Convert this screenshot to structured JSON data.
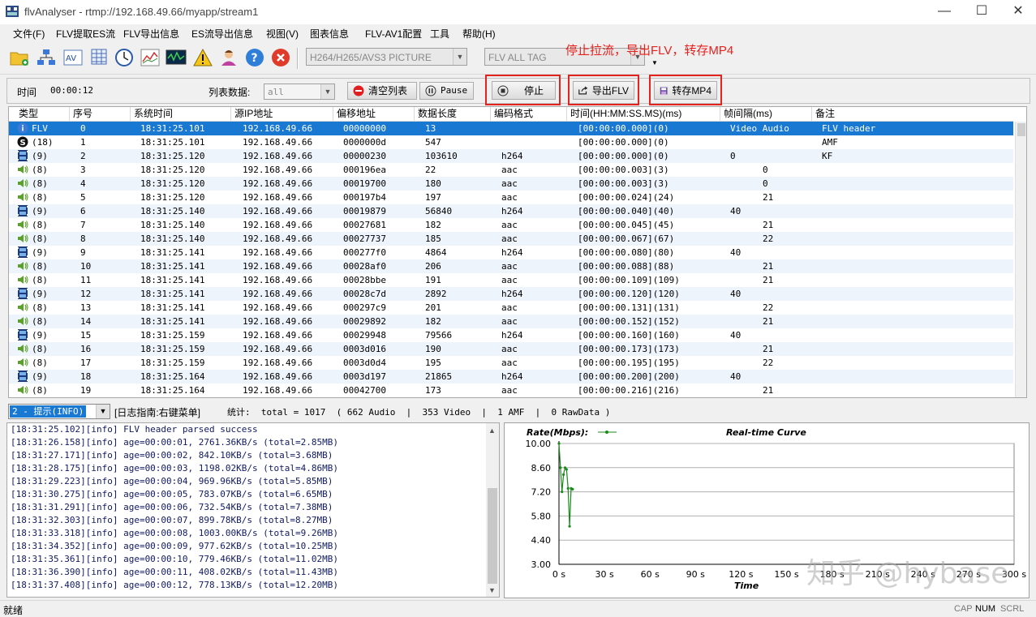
{
  "window": {
    "title": "flvAnalyser - rtmp://192.168.49.66/myapp/stream1",
    "minimize": "—",
    "maximize": "☐",
    "close": "✕"
  },
  "menu": [
    "文件(F)",
    "FLV提取ES流",
    "FLV导出信息",
    "ES流导出信息",
    "视图(V)",
    "图表信息",
    "FLV-AV1配置",
    "工具",
    "帮助(H)"
  ],
  "toolbar": {
    "icons": [
      "open-folder-icon",
      "network-icon",
      "av-icon",
      "grid-icon",
      "clock-icon",
      "chart-icon",
      "monitor-wave-icon",
      "warning-icon",
      "user-icon",
      "help-icon",
      "stop-circle-icon"
    ],
    "picture_combo": "H264/H265/AVS3 PICTURE",
    "tag_combo": "FLV ALL TAG"
  },
  "annotation": "停止拉流，导出FLV，转存MP4",
  "controls": {
    "time_label": "时间",
    "time_value": "00:00:12",
    "list_data_label": "列表数据:",
    "list_data_value": "all",
    "clear_label": "清空列表",
    "pause_label": "Pause",
    "stop_label": "停止",
    "export_flv_label": "导出FLV",
    "to_mp4_label": "转存MP4"
  },
  "table": {
    "columns": [
      "类型",
      "序号",
      "系统时间",
      "源IP地址",
      "偏移地址",
      "数据长度",
      "编码格式",
      "时间(HH:MM:SS.MS)(ms)",
      "帧间隔(ms)",
      "备注"
    ],
    "rows": [
      {
        "icon": "info",
        "type": "FLV",
        "seq": "0",
        "time": "18:31:25.101",
        "ip": "192.168.49.66",
        "offset": "00000000",
        "len": "13",
        "codec": "",
        "ts": "[00:00:00.000](0)",
        "interval": "Video  Audio",
        "note": "FLV header"
      },
      {
        "icon": "script",
        "type": "(18)",
        "seq": "1",
        "time": "18:31:25.101",
        "ip": "192.168.49.66",
        "offset": "0000000d",
        "len": "547",
        "codec": "",
        "ts": "[00:00:00.000](0)",
        "interval": "",
        "note": "AMF"
      },
      {
        "icon": "video",
        "type": "(9)",
        "seq": "2",
        "time": "18:31:25.120",
        "ip": "192.168.49.66",
        "offset": "00000230",
        "len": "103610",
        "codec": "h264",
        "ts": "[00:00:00.000](0)",
        "interval": "0",
        "note": "KF"
      },
      {
        "icon": "audio",
        "type": "(8)",
        "seq": "3",
        "time": "18:31:25.120",
        "ip": "192.168.49.66",
        "offset": "000196ea",
        "len": "22",
        "codec": "aac",
        "ts": "[00:00:00.003](3)",
        "interval": "0",
        "note": ""
      },
      {
        "icon": "audio",
        "type": "(8)",
        "seq": "4",
        "time": "18:31:25.120",
        "ip": "192.168.49.66",
        "offset": "00019700",
        "len": "180",
        "codec": "aac",
        "ts": "[00:00:00.003](3)",
        "interval": "0",
        "note": ""
      },
      {
        "icon": "audio",
        "type": "(8)",
        "seq": "5",
        "time": "18:31:25.120",
        "ip": "192.168.49.66",
        "offset": "000197b4",
        "len": "197",
        "codec": "aac",
        "ts": "[00:00:00.024](24)",
        "interval": "21",
        "note": ""
      },
      {
        "icon": "video",
        "type": "(9)",
        "seq": "6",
        "time": "18:31:25.140",
        "ip": "192.168.49.66",
        "offset": "00019879",
        "len": "56840",
        "codec": "h264",
        "ts": "[00:00:00.040](40)",
        "interval": "40",
        "note": ""
      },
      {
        "icon": "audio",
        "type": "(8)",
        "seq": "7",
        "time": "18:31:25.140",
        "ip": "192.168.49.66",
        "offset": "00027681",
        "len": "182",
        "codec": "aac",
        "ts": "[00:00:00.045](45)",
        "interval": "21",
        "note": ""
      },
      {
        "icon": "audio",
        "type": "(8)",
        "seq": "8",
        "time": "18:31:25.140",
        "ip": "192.168.49.66",
        "offset": "00027737",
        "len": "185",
        "codec": "aac",
        "ts": "[00:00:00.067](67)",
        "interval": "22",
        "note": ""
      },
      {
        "icon": "video",
        "type": "(9)",
        "seq": "9",
        "time": "18:31:25.141",
        "ip": "192.168.49.66",
        "offset": "000277f0",
        "len": "4864",
        "codec": "h264",
        "ts": "[00:00:00.080](80)",
        "interval": "40",
        "note": ""
      },
      {
        "icon": "audio",
        "type": "(8)",
        "seq": "10",
        "time": "18:31:25.141",
        "ip": "192.168.49.66",
        "offset": "00028af0",
        "len": "206",
        "codec": "aac",
        "ts": "[00:00:00.088](88)",
        "interval": "21",
        "note": ""
      },
      {
        "icon": "audio",
        "type": "(8)",
        "seq": "11",
        "time": "18:31:25.141",
        "ip": "192.168.49.66",
        "offset": "00028bbe",
        "len": "191",
        "codec": "aac",
        "ts": "[00:00:00.109](109)",
        "interval": "21",
        "note": ""
      },
      {
        "icon": "video",
        "type": "(9)",
        "seq": "12",
        "time": "18:31:25.141",
        "ip": "192.168.49.66",
        "offset": "00028c7d",
        "len": "2892",
        "codec": "h264",
        "ts": "[00:00:00.120](120)",
        "interval": "40",
        "note": ""
      },
      {
        "icon": "audio",
        "type": "(8)",
        "seq": "13",
        "time": "18:31:25.141",
        "ip": "192.168.49.66",
        "offset": "000297c9",
        "len": "201",
        "codec": "aac",
        "ts": "[00:00:00.131](131)",
        "interval": "22",
        "note": ""
      },
      {
        "icon": "audio",
        "type": "(8)",
        "seq": "14",
        "time": "18:31:25.141",
        "ip": "192.168.49.66",
        "offset": "00029892",
        "len": "182",
        "codec": "aac",
        "ts": "[00:00:00.152](152)",
        "interval": "21",
        "note": ""
      },
      {
        "icon": "video",
        "type": "(9)",
        "seq": "15",
        "time": "18:31:25.159",
        "ip": "192.168.49.66",
        "offset": "00029948",
        "len": "79566",
        "codec": "h264",
        "ts": "[00:00:00.160](160)",
        "interval": "40",
        "note": ""
      },
      {
        "icon": "audio",
        "type": "(8)",
        "seq": "16",
        "time": "18:31:25.159",
        "ip": "192.168.49.66",
        "offset": "0003d016",
        "len": "190",
        "codec": "aac",
        "ts": "[00:00:00.173](173)",
        "interval": "21",
        "note": ""
      },
      {
        "icon": "audio",
        "type": "(8)",
        "seq": "17",
        "time": "18:31:25.159",
        "ip": "192.168.49.66",
        "offset": "0003d0d4",
        "len": "195",
        "codec": "aac",
        "ts": "[00:00:00.195](195)",
        "interval": "22",
        "note": ""
      },
      {
        "icon": "video",
        "type": "(9)",
        "seq": "18",
        "time": "18:31:25.164",
        "ip": "192.168.49.66",
        "offset": "0003d197",
        "len": "21865",
        "codec": "h264",
        "ts": "[00:00:00.200](200)",
        "interval": "40",
        "note": ""
      },
      {
        "icon": "audio",
        "type": "(8)",
        "seq": "19",
        "time": "18:31:25.164",
        "ip": "192.168.49.66",
        "offset": "00042700",
        "len": "173",
        "codec": "aac",
        "ts": "[00:00:00.216](216)",
        "interval": "21",
        "note": ""
      }
    ]
  },
  "stats": {
    "level": "2 - 提示(INFO)",
    "log_hint": "[日志指南:右键菜单]",
    "text": "统计:  total = 1017  ( 662 Audio  |  353 Video  |  1 AMF  |  0 RawData )"
  },
  "log": [
    "[18:31:25.102][info] FLV header parsed success",
    "[18:31:26.158][info] age=00:00:01, 2761.36KB/s (total=2.85MB)",
    "[18:31:27.171][info] age=00:00:02, 842.10KB/s (total=3.68MB)",
    "[18:31:28.175][info] age=00:00:03, 1198.02KB/s (total=4.86MB)",
    "[18:31:29.223][info] age=00:00:04, 969.96KB/s (total=5.85MB)",
    "[18:31:30.275][info] age=00:00:05, 783.07KB/s (total=6.65MB)",
    "[18:31:31.291][info] age=00:00:06, 732.54KB/s (total=7.38MB)",
    "[18:31:32.303][info] age=00:00:07, 899.78KB/s (total=8.27MB)",
    "[18:31:33.318][info] age=00:00:08, 1003.00KB/s (total=9.26MB)",
    "[18:31:34.352][info] age=00:00:09, 977.62KB/s (total=10.25MB)",
    "[18:31:35.361][info] age=00:00:10, 779.46KB/s (total=11.02MB)",
    "[18:31:36.390][info] age=00:00:11, 408.02KB/s (total=11.43MB)",
    "[18:31:37.408][info] age=00:00:12, 778.13KB/s (total=12.20MB)"
  ],
  "chart_data": {
    "type": "line",
    "title": "Real-time Curve",
    "ylabel": "Rate(Mbps):",
    "xlabel": "Time",
    "ylim": [
      3.0,
      10.0
    ],
    "xlim": [
      0,
      300
    ],
    "yticks": [
      "10.00",
      "8.60",
      "7.20",
      "5.80",
      "4.40",
      "3.00"
    ],
    "xticks": [
      "0 s",
      "30 s",
      "60 s",
      "90 s",
      "120 s",
      "150 s",
      "180 s",
      "210 s",
      "240 s",
      "270 s",
      "300 s"
    ],
    "grid": true,
    "color": "#1a8a1a",
    "series": [
      {
        "x": [
          0,
          1,
          2,
          3,
          4,
          5,
          6,
          7,
          8,
          9,
          10,
          11,
          12
        ],
        "y": [
          10.0,
          8.6,
          7.2,
          8.2,
          8.6,
          8.5,
          7.4,
          5.2,
          7.4,
          7.35,
          null,
          null,
          null
        ]
      }
    ]
  },
  "status": {
    "ready": "就绪",
    "cap": "CAP",
    "num": "NUM",
    "scrl": "SCRL"
  },
  "watermark": "知乎 @hybase"
}
